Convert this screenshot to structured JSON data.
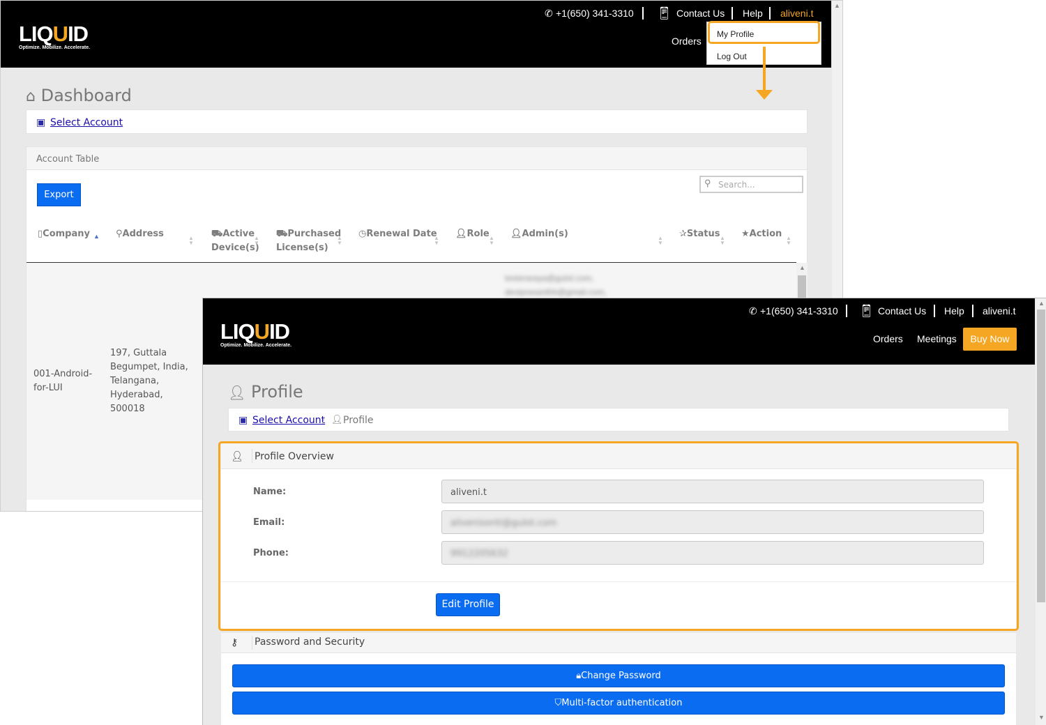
{
  "brand": {
    "logo_main_left": "LIQ",
    "logo_main_u": "U",
    "logo_main_right": "ID",
    "logo_tagline": "Optimize. Mobilize. Accelerate."
  },
  "header": {
    "phone": "+1(650) 341-3310",
    "contact": "Contact Us",
    "help": "Help",
    "user": "aliveni.t",
    "nav_orders": "Orders",
    "nav_meetings": "Meetings",
    "buy_now": "Buy Now"
  },
  "user_menu": {
    "my_profile": "My Profile",
    "log_out": "Log Out"
  },
  "dashboard": {
    "title": "Dashboard",
    "select_account": "Select Account",
    "table_title": "Account Table",
    "export": "Export",
    "search_placeholder": "Search...",
    "columns": [
      {
        "l1": "Company",
        "l2": ""
      },
      {
        "l1": "Address",
        "l2": ""
      },
      {
        "l1": "Active",
        "l2": "Device(s)"
      },
      {
        "l1": "Purchased",
        "l2": "License(s)"
      },
      {
        "l1": "Renewal Date",
        "l2": ""
      },
      {
        "l1": "Role",
        "l2": ""
      },
      {
        "l1": "Admin(s)",
        "l2": ""
      },
      {
        "l1": "Status",
        "l2": ""
      },
      {
        "l1": "Action",
        "l2": ""
      }
    ],
    "row": {
      "company_l1": "001-Android-",
      "company_l2": "for-LUI",
      "address": [
        "197, Guttala",
        "Begumpet, India,",
        "Telangana,",
        "Hyderabad,",
        "500018"
      ],
      "admins": [
        "testeraraya@gulot.com,",
        "deviprasanthh@gmail.com,"
      ]
    }
  },
  "profile": {
    "title": "Profile",
    "breadcrumb_root": "Select Account",
    "breadcrumb_sep": "/",
    "breadcrumb_current": "Profile",
    "overview_title": "Profile Overview",
    "name_label": "Name:",
    "name_value": "aliveni.t",
    "email_label": "Email:",
    "email_value": "alivenisonti@gulot.com",
    "phone_label": "Phone:",
    "phone_value": "9912205632",
    "edit_button": "Edit Profile",
    "security_title": "Password and Security",
    "change_password": "Change Password",
    "mfa": "Multi-factor authentication"
  },
  "colors": {
    "accent": "#f5a623",
    "primary": "#0a6cf1",
    "header_bg": "#000000",
    "page_bg": "#e9e9e9"
  }
}
